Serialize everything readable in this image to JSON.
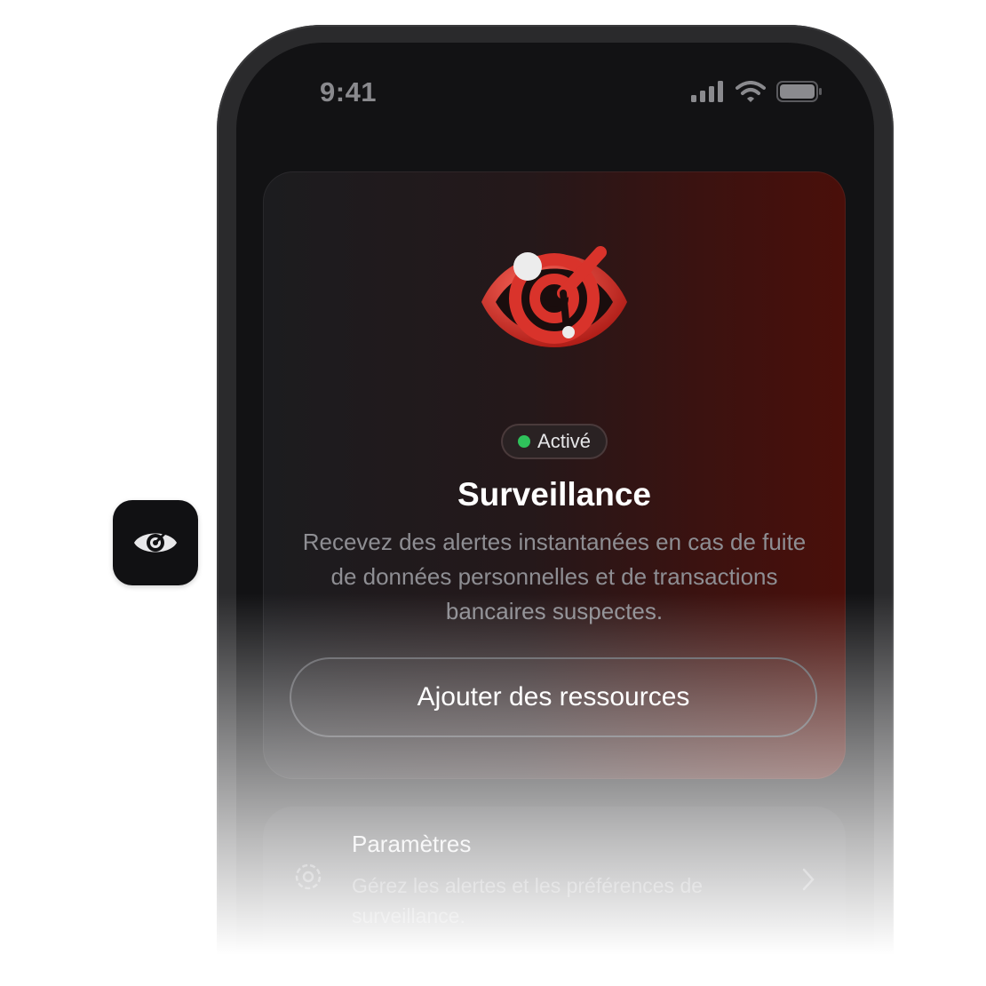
{
  "status_bar": {
    "time": "9:41"
  },
  "side_icon": {
    "icon": "eye-icon"
  },
  "card": {
    "hero_icon": "surveillance-eye-icon",
    "badge": "Activé",
    "badge_color": "#2fc25b",
    "title": "Surveillance",
    "description": "Recevez des alertes instantanées en cas de fuite de données personnelles et de transactions bancaires suspectes.",
    "button": "Ajouter des ressources"
  },
  "settings": {
    "icon": "gear-icon",
    "title": "Paramètres",
    "subtitle": "Gérez les alertes et les préférences de surveillance."
  },
  "colors": {
    "accent": "#d93a32",
    "background": "#121214"
  }
}
